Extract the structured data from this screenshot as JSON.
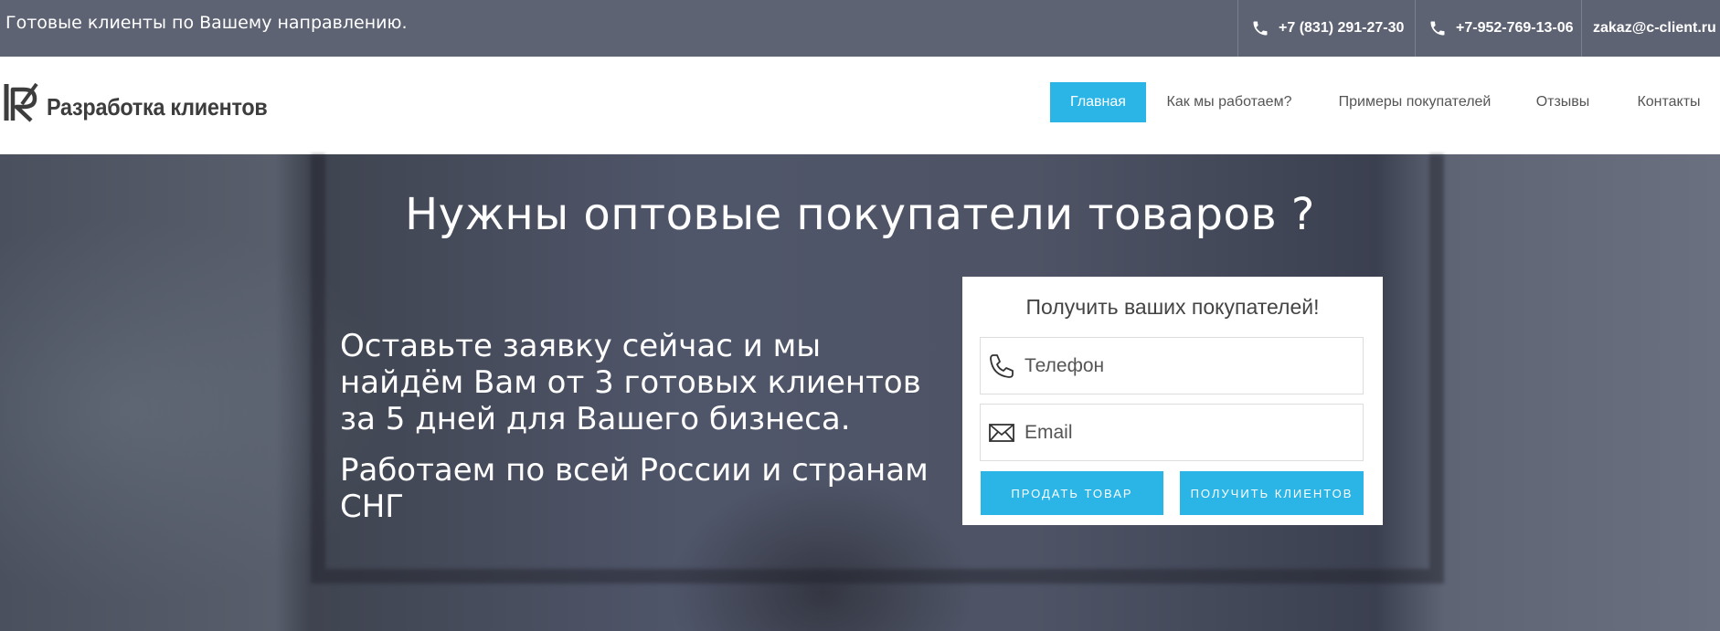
{
  "topbar": {
    "tagline": "Готовые клиенты по Вашему направлению.",
    "phone1": "+7 (831) 291-27-30",
    "phone2": "+7-952-769-13-06",
    "email": "zakaz@c-client.ru"
  },
  "header": {
    "brand": "Разработка клиентов",
    "nav": [
      {
        "label": "Главная",
        "active": true
      },
      {
        "label": "Как мы работаем?"
      },
      {
        "label": "Примеры покупателей"
      },
      {
        "label": "Отзывы"
      },
      {
        "label": "Контакты"
      }
    ]
  },
  "hero": {
    "headline": "Нужны оптовые покупатели товаров ?",
    "lead": "Оставьте заявку сейчас и мы найдём Вам от 3 готовых клиентов за 5 дней для Вашего бизнеса.",
    "sub": "Работаем по всей России и странам СНГ"
  },
  "form": {
    "title": "Получить ваших покупателей!",
    "phone_placeholder": "Телефон",
    "email_placeholder": "Email",
    "sell_button": "ПРОДАТЬ ТОВАР",
    "get_button": "ПОЛУЧИТЬ КЛИЕНТОВ"
  },
  "colors": {
    "accent": "#2bb5e7",
    "topbar": "#5d6373"
  }
}
